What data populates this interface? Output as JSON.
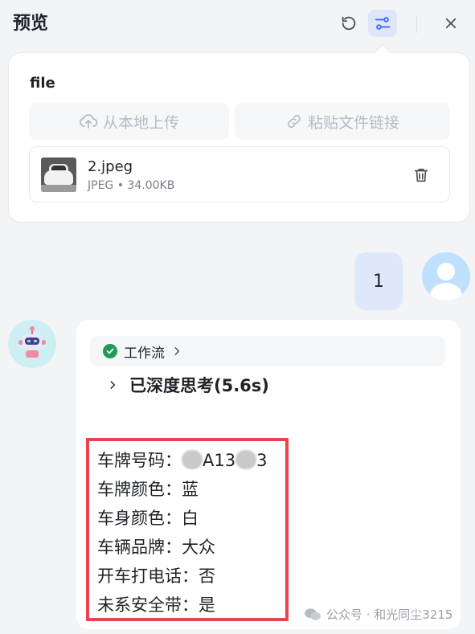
{
  "header": {
    "title": "预览"
  },
  "file_panel": {
    "label": "file",
    "upload_local": "从本地上传",
    "paste_link": "粘贴文件链接",
    "file": {
      "name": "2.jpeg",
      "type": "JPEG",
      "size": "34.00KB"
    }
  },
  "user_message": {
    "text": "1"
  },
  "bot": {
    "workflow_label": "工作流",
    "thinking_label": "已深度思考(5.6s)",
    "result": {
      "plate": {
        "key": "车牌号码：",
        "visible_a": "A13",
        "visible_b": "3"
      },
      "plate_color": "车牌颜色：蓝",
      "body_color": "车身颜色：白",
      "brand": "车辆品牌：大众",
      "phone": "开车打电话：否",
      "seatbelt": "未系安全带：是"
    }
  },
  "watermark": {
    "text": "公众号 · 和光同尘3215"
  },
  "colors": {
    "accent": "#3b6ef5",
    "highlight_border": "#e8454d",
    "success": "#1f9d55"
  }
}
